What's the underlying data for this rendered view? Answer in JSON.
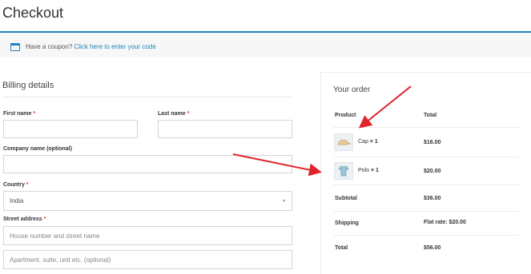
{
  "page": {
    "title": "Checkout"
  },
  "coupon": {
    "prompt": "Have a coupon?",
    "link": "Click here to enter your code"
  },
  "billing": {
    "title": "Billing details",
    "first_name_label": "First name",
    "last_name_label": "Last name",
    "company_label": "Company name (optional)",
    "country_label": "Country",
    "country_value": "India",
    "street_label": "Street address",
    "street_placeholder_1": "House number and street name",
    "street_placeholder_2": "Apartment, suite, unit etc. (optional)",
    "required_mark": "*"
  },
  "order": {
    "title": "Your order",
    "col_product": "Product",
    "col_total": "Total",
    "items": [
      {
        "name": "Cap",
        "qty": "× 1",
        "total": "$16.00",
        "icon": "cap-icon"
      },
      {
        "name": "Polo",
        "qty": "× 1",
        "total": "$20.00",
        "icon": "polo-shirt-icon"
      }
    ],
    "subtotal_label": "Subtotal",
    "subtotal_value": "$36.00",
    "shipping_label": "Shipping",
    "shipping_value": "Flat rate: $20.00",
    "total_label": "Total",
    "total_value": "$56.00"
  },
  "annotations": {
    "arrow_color": "#e0242b"
  },
  "colors": {
    "accent": "#1e85be",
    "required": "#e2401c"
  }
}
